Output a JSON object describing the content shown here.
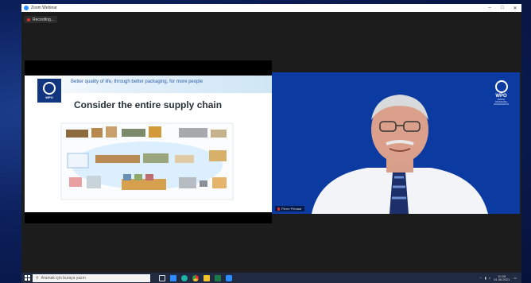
{
  "window": {
    "title": "Zoom Webinar"
  },
  "recording": {
    "label": "Recording..."
  },
  "slide": {
    "tagline": "Better quality of life, through better packaging, for more people",
    "logo_text": "WPO",
    "title": "Consider the entire supply chain"
  },
  "video": {
    "logo_name": "WPO",
    "logo_sub_1": "WORLD",
    "logo_sub_2": "PACKAGING",
    "logo_sub_3": "ORGANISATION",
    "participant_name": "Pierre Pienaar"
  },
  "taskbar": {
    "search_placeholder": "Aramak için buraya yazın",
    "time": "10:28",
    "date": "01.06.2021"
  },
  "colors": {
    "zoom_blue": "#2d8cff",
    "video_bg": "#0b3aa0",
    "record_red": "#e03131"
  }
}
